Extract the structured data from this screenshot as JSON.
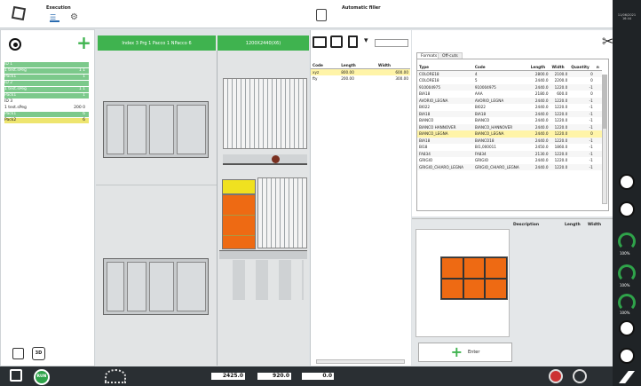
{
  "header": {
    "execution_label": "Execution",
    "auto_filler_label": "Automatic filler"
  },
  "left": {
    "tree": [
      {
        "label": "ID 1",
        "style": "g",
        "value": ""
      },
      {
        "label": "1  test.sPeg",
        "style": "g",
        "value": "1   1"
      },
      {
        "label": "Pack1",
        "style": "g",
        "value": "1"
      },
      {
        "label": "ID 2",
        "style": "g",
        "value": ""
      },
      {
        "label": "1  test.sPeg",
        "style": "g",
        "value": "1   1"
      },
      {
        "label": "Pack1",
        "style": "g",
        "value": "1"
      },
      {
        "label": "ID 3",
        "style": "n",
        "value": ""
      },
      {
        "label": "1  test.sPeg",
        "style": "n",
        "value": "200  0"
      },
      {
        "label": "Pack1",
        "style": "g",
        "value": "6"
      },
      {
        "label": "Pack2",
        "style": "y",
        "value": "6"
      }
    ]
  },
  "center": {
    "index_header": "Index 3 Prg 1 Pacco 1 NPacco 6",
    "size_header": "1200X2440(X6)"
  },
  "files": {
    "headers": [
      "Code",
      "Length",
      "Width"
    ],
    "rows": [
      [
        "xyz",
        "800.00",
        "600.00"
      ],
      [
        "fty",
        "200.00",
        "300.00"
      ]
    ]
  },
  "formats": {
    "tabs": [
      "Formats",
      "Off-cuts"
    ],
    "headers": [
      "Type",
      "Code",
      "Length",
      "Width",
      "Quantity",
      "n"
    ],
    "rows": [
      [
        "COLORE18",
        "4",
        "2800.0",
        "2100.0",
        "0",
        ""
      ],
      [
        "COLORE18",
        "5",
        "2440.0",
        "2200.0",
        "0",
        ""
      ],
      [
        "910004975",
        "910004975",
        "2440.0",
        "1220.0",
        "-1",
        ""
      ],
      [
        "BIA18",
        "AAA",
        "2180.0",
        "600.0",
        "0",
        ""
      ],
      [
        "AVORIO_LEGNA",
        "AVORIO_LEGNA",
        "2440.0",
        "1220.0",
        "-1",
        ""
      ],
      [
        "BI022",
        "BI022",
        "2440.0",
        "1220.0",
        "-1",
        ""
      ],
      [
        "BIA18",
        "BIA18",
        "2440.0",
        "1220.0",
        "-1",
        ""
      ],
      [
        "BIANCO",
        "BIANCO",
        "2440.0",
        "1220.0",
        "-1",
        ""
      ],
      [
        "BIANCO HANNOVER",
        "BIANCO_HANNOVER",
        "2440.0",
        "1220.0",
        "-1",
        ""
      ],
      [
        "BIANCO_LEGNA",
        "BIANCO_LEGNA",
        "2440.0",
        "1220.0",
        "0",
        ""
      ],
      [
        "BIA18",
        "BIANCO18",
        "2440.0",
        "1220.0",
        "-1",
        ""
      ],
      [
        "BI18",
        "BI1,000011",
        "2450.0",
        "1860.0",
        "-1",
        ""
      ],
      [
        "FA834",
        "FA834",
        "2130.0",
        "1220.0",
        "-1",
        ""
      ],
      [
        "GRIGIO",
        "GRIGIO",
        "2440.0",
        "1220.0",
        "-1",
        ""
      ],
      [
        "GRIGIO_CHIARO_LEGNA",
        "GRIGIO_CHIARO_LEGNA",
        "2440.0",
        "1220.0",
        "-1",
        ""
      ]
    ],
    "selected_row": 9
  },
  "lower": {
    "headers": [
      "Description",
      "Length",
      "Width"
    ],
    "enter_label": "Enter"
  },
  "bottom": {
    "run_label": "RUN",
    "v1": "2425.0",
    "v2": "920.0",
    "v3": "0.0"
  },
  "rail": {
    "time": "11/06/2021\n16:44",
    "g1": "100%",
    "g2": "100%",
    "g3": "100%"
  }
}
